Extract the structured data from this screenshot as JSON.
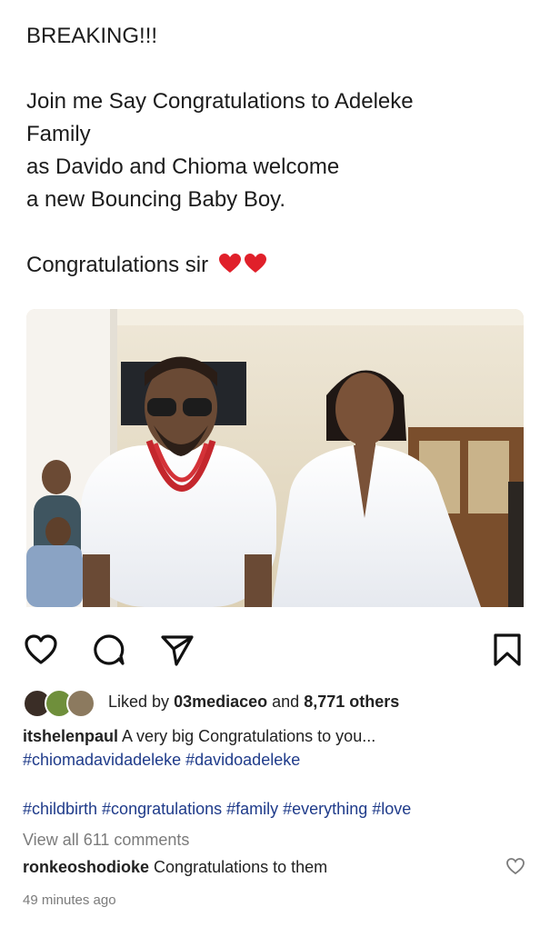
{
  "caption": {
    "line1": "BREAKING!!!",
    "line2": "Join me Say Congratulations to Adeleke",
    "line3": "Family",
    "line4": "as Davido and Chioma welcome",
    "line5": "a new Bouncing Baby Boy.",
    "line6": "Congratulations sir"
  },
  "post": {
    "liked_by_prefix": "Liked by",
    "liked_by_user": "03mediaceo",
    "liked_by_suffix": "and",
    "liked_by_others": "8,771 others",
    "comment_user": "itshelenpaul",
    "comment_text": "A very big Congratulations to you...",
    "comment_tags": "#chiomadavidadeleke #davidoadeleke",
    "hashtags": "#childbirth #congratulations #family #everything #love",
    "view_all": "View all 611 comments",
    "reply_user": "ronkeoshodioke",
    "reply_text": "Congratulations to them",
    "timestamp": "49 minutes ago"
  },
  "icons": {
    "like": "heart-outline-icon",
    "comment": "comment-bubble-icon",
    "share": "paper-plane-icon",
    "save": "bookmark-icon"
  },
  "colors": {
    "hashtag": "#1f3b8a",
    "heart_emoji": "#e0202a",
    "muted": "#7b7b7b"
  }
}
